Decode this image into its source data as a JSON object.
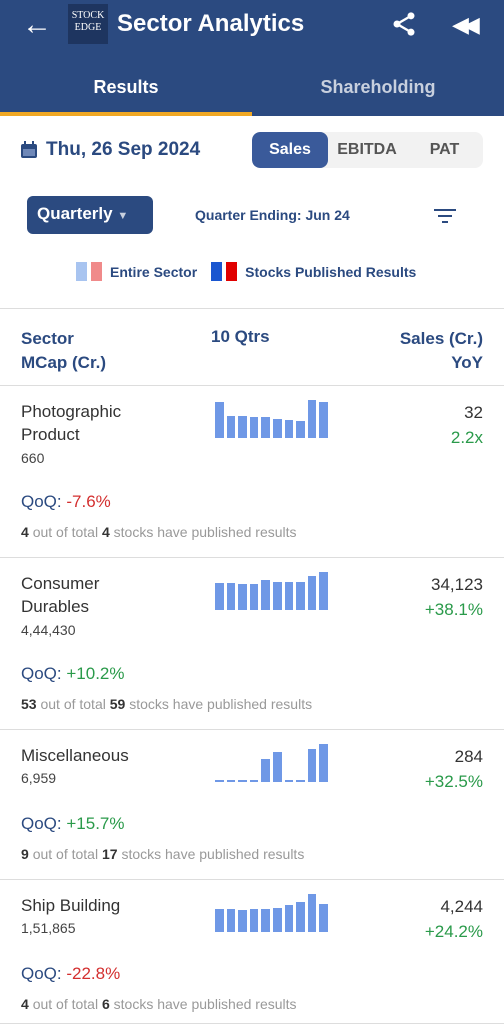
{
  "header": {
    "title": "Sector Analytics",
    "logo_text": "STOCK EDGE"
  },
  "tabs": [
    {
      "label": "Results"
    },
    {
      "label": "Shareholding"
    }
  ],
  "date": "Thu, 26 Sep 2024",
  "metrics": [
    "Sales",
    "EBITDA",
    "PAT"
  ],
  "period": "Quarterly",
  "quarter_ending": "Quarter Ending: Jun 24",
  "legend": {
    "entire": "Entire Sector",
    "published": "Stocks Published Results",
    "colors": [
      "#a8c4f0",
      "#f08a8a",
      "#1a56d0",
      "#e00000"
    ]
  },
  "columns": {
    "left1": "Sector",
    "left2": "MCap (Cr.)",
    "center": "10 Qtrs",
    "right1": "Sales (Cr.)",
    "right2": "YoY"
  },
  "sectors": [
    {
      "name": "Photographic Product",
      "mcap": "660",
      "sales": "32",
      "yoy": "2.2x",
      "qoq_label": "QoQ:",
      "qoq": "-7.6%",
      "published": "4",
      "total": "4",
      "bars": [
        0.95,
        0.58,
        0.58,
        0.55,
        0.55,
        0.5,
        0.48,
        0.45,
        1.0,
        0.95
      ]
    },
    {
      "name": "Consumer Durables",
      "mcap": "4,44,430",
      "sales": "34,123",
      "yoy": "+38.1%",
      "qoq_label": "QoQ:",
      "qoq": "+10.2%",
      "published": "53",
      "total": "59",
      "bars": [
        0.72,
        0.72,
        0.68,
        0.68,
        0.8,
        0.75,
        0.75,
        0.75,
        0.9,
        1.0
      ]
    },
    {
      "name": "Miscellaneous",
      "mcap": "6,959",
      "sales": "284",
      "yoy": "+32.5%",
      "qoq_label": "QoQ:",
      "qoq": "+15.7%",
      "published": "9",
      "total": "17",
      "bars": [
        0.06,
        0.06,
        0.06,
        0.05,
        0.6,
        0.78,
        0.04,
        0.04,
        0.88,
        1.0
      ]
    },
    {
      "name": "Ship Building",
      "mcap": "1,51,865",
      "sales": "4,244",
      "yoy": "+24.2%",
      "qoq_label": "QoQ:",
      "qoq": "-22.8%",
      "published": "4",
      "total": "6",
      "bars": [
        0.6,
        0.6,
        0.58,
        0.6,
        0.6,
        0.62,
        0.7,
        0.8,
        1.0,
        0.75
      ]
    }
  ],
  "pub_text": {
    "mid": "out of total",
    "end": "stocks have published results"
  }
}
